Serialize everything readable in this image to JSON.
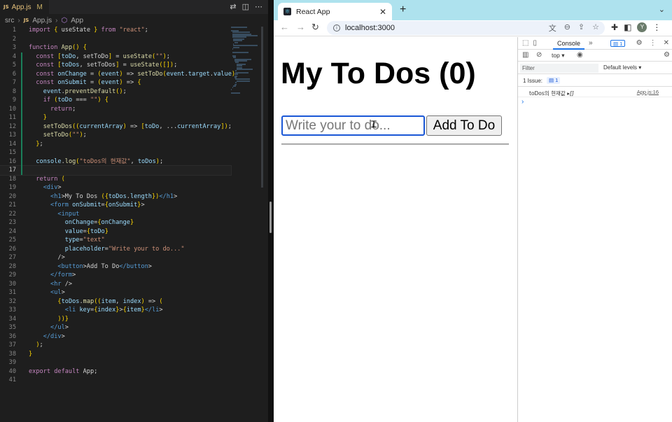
{
  "vscode": {
    "tab": {
      "badge": "JS",
      "filename": "App.js",
      "status": "M"
    },
    "breadcrumb": {
      "folder": "src",
      "file_badge": "JS",
      "file": "App.js",
      "symbol": "App"
    },
    "code_lines": [
      "import { useState } from \"react\";",
      "",
      "function App() {",
      "  const [toDo, setToDo] = useState(\"\");",
      "  const [toDos, setToDos] = useState([]);",
      "  const onChange = (event) => setToDo(event.target.value)",
      "  const onSubmit = (event) => {",
      "    event.preventDefault();",
      "    if (toDo === \"\") {",
      "      return;",
      "    }",
      "    setToDos((currentArray) => [toDo, ...currentArray]);",
      "    setToDo(\"\");",
      "  };",
      "",
      "  console.log(\"toDos의 현재값\", toDos);",
      "",
      "  return (",
      "    <div>",
      "      <h1>My To Dos ({toDos.length})</h1>",
      "      <form onSubmit={onSubmit}>",
      "        <input",
      "          onChange={onChange}",
      "          value={toDo}",
      "          type=\"text\"",
      "          placeholder=\"Write your to do...\"",
      "        />",
      "        <button>Add To Do</button>",
      "      </form>",
      "      <hr />",
      "      <ul>",
      "        {toDos.map((item, index) => (",
      "          <li key={index}>{item}</li>",
      "        ))}",
      "      </ul>",
      "    </div>",
      "  );",
      "}",
      "",
      "export default App;",
      ""
    ],
    "current_line": 17
  },
  "chrome": {
    "tab_title": "React App",
    "url": "localhost:3000",
    "avatar_letter": "Y",
    "page": {
      "title": "My To Dos (0)",
      "input_placeholder": "Write your to do...",
      "input_value": "",
      "button_label": "Add To Do"
    },
    "devtools": {
      "tab_console": "Console",
      "issues_badge": "1",
      "context": "top",
      "filter_placeholder": "Filter",
      "levels": "Default levels",
      "issue_label": "1 Issue:",
      "issue_count": "1",
      "log_message": "toDos의 현재값",
      "log_value": "[]",
      "log_source": "App.js:16"
    }
  }
}
